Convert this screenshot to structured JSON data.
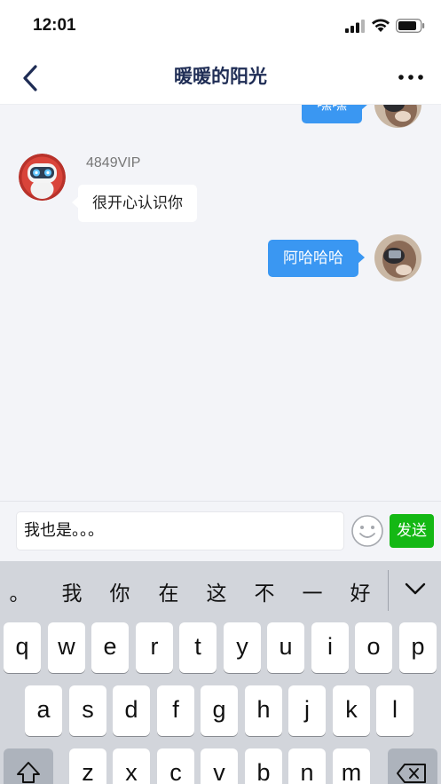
{
  "status_bar": {
    "time": "12:01",
    "signal_icon": "cellular-signal-icon",
    "wifi_icon": "wifi-icon",
    "battery_icon": "battery-icon"
  },
  "nav": {
    "title": "暖暖的阳光",
    "back_icon": "back-chevron-icon",
    "more_icon": "more-dots-icon"
  },
  "chat": {
    "messages": [
      {
        "direction": "out",
        "text": "嘿嘿",
        "partial": true
      },
      {
        "direction": "in",
        "sender": "4849VIP",
        "text": "很开心认识你"
      },
      {
        "direction": "out",
        "text": "阿哈哈哈"
      }
    ]
  },
  "composer": {
    "input_value": "我也是。。。",
    "emoji_icon": "emoji-face-icon",
    "send_label": "发送"
  },
  "keyboard": {
    "candidates": [
      "。",
      "我",
      "你",
      "在",
      "这",
      "不",
      "一",
      "好"
    ],
    "collapse_icon": "collapse-keyboard-icon",
    "row1": [
      "q",
      "w",
      "e",
      "r",
      "t",
      "y",
      "u",
      "i",
      "o",
      "p"
    ],
    "row2": [
      "a",
      "s",
      "d",
      "f",
      "g",
      "h",
      "j",
      "k",
      "l"
    ],
    "row3": [
      "z",
      "x",
      "c",
      "v",
      "b",
      "n",
      "m"
    ],
    "shift_icon": "shift-icon",
    "delete_icon": "backspace-icon"
  },
  "colors": {
    "outgoing_bubble": "#3a97f2",
    "send_button": "#14b814",
    "title": "#1f2d55"
  }
}
